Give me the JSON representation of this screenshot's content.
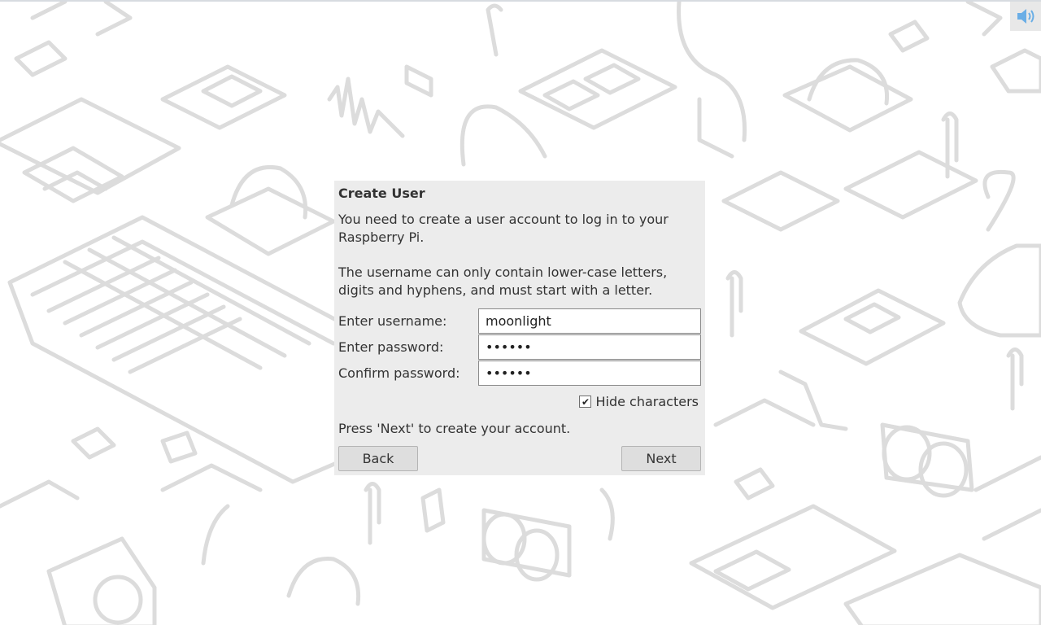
{
  "dialog": {
    "title": "Create User",
    "intro": "You need to create a user account to log in to your Raspberry Pi.",
    "rules": "The username can only contain lower-case letters, digits and hyphens, and must start with a letter.",
    "fields": [
      {
        "label": "Enter username:",
        "value": "moonlight"
      },
      {
        "label": "Enter password:",
        "value": "••••••"
      },
      {
        "label": "Confirm password:",
        "value": "••••••"
      }
    ],
    "hide_characters": {
      "label": "Hide characters",
      "checked": true
    },
    "footer_text": "Press 'Next' to create your account.",
    "back_label": "Back",
    "next_label": "Next"
  },
  "tray": {
    "icon": "volume-icon"
  },
  "colors": {
    "wallpaper_line": "#dcdcdc",
    "dialog_bg": "#ececec",
    "button_bg": "#dedede",
    "volume_icon": "#6aaee6"
  }
}
